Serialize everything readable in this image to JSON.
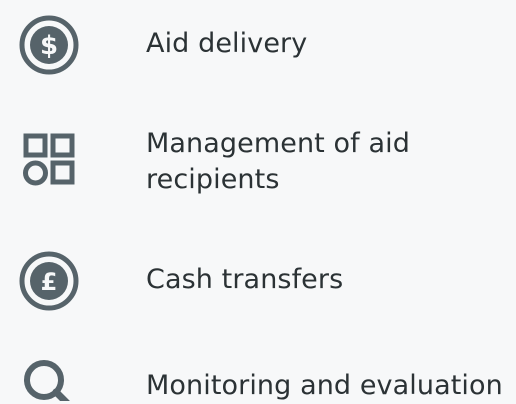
{
  "colors": {
    "icon": "#56636a",
    "text": "#2b3235",
    "background": "#f7f8f9"
  },
  "items": [
    {
      "icon": "dollar-circle-icon",
      "label": "Aid delivery"
    },
    {
      "icon": "grid-shapes-icon",
      "label": "Management of aid recipients"
    },
    {
      "icon": "pound-circle-icon",
      "label": "Cash transfers"
    },
    {
      "icon": "magnifier-icon",
      "label": "Monitoring and evaluation"
    }
  ]
}
